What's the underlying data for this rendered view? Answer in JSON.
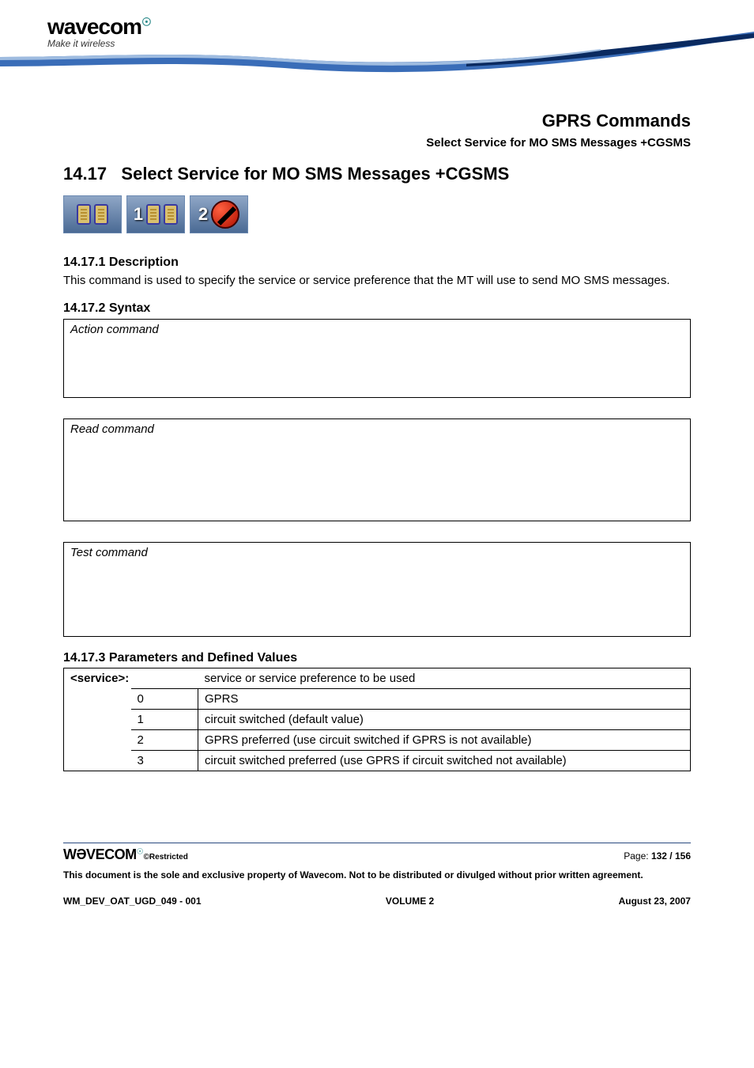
{
  "logo": {
    "brand": "wavecom",
    "tagline": "Make it wireless"
  },
  "header": {
    "category": "GPRS Commands",
    "subtitle": "Select Service for MO SMS Messages +CGSMS"
  },
  "section": {
    "number": "14.17",
    "title": "Select Service for MO SMS Messages +CGSMS"
  },
  "icons": {
    "badge2_num": "1",
    "badge3_num": "2"
  },
  "desc": {
    "heading": "14.17.1 Description",
    "text": "This command is used to specify the service or service preference that the MT will use to send MO SMS messages."
  },
  "syntax": {
    "heading": "14.17.2 Syntax",
    "action_label": "Action command",
    "read_label": "Read command",
    "test_label": "Test command"
  },
  "params": {
    "heading": "14.17.3 Parameters and Defined Values",
    "name": "<service>:",
    "summary": "service or service preference to be used",
    "rows": [
      {
        "val": "0",
        "desc": "GPRS"
      },
      {
        "val": "1",
        "desc": "circuit switched (default value)"
      },
      {
        "val": "2",
        "desc": "GPRS preferred (use circuit switched if GPRS is not available)"
      },
      {
        "val": "3",
        "desc": "circuit switched preferred (use GPRS if circuit switched not available)"
      }
    ]
  },
  "footer": {
    "brand": "WƏVECOM",
    "restricted": "©Restricted",
    "page_label": "Page: ",
    "page_num": "132 / 156",
    "notice": "This document is the sole and exclusive property of Wavecom. Not to be distributed or divulged without prior written agreement.",
    "doc_id": "WM_DEV_OAT_UGD_049 - 001",
    "volume": "VOLUME 2",
    "date": "August 23, 2007"
  }
}
